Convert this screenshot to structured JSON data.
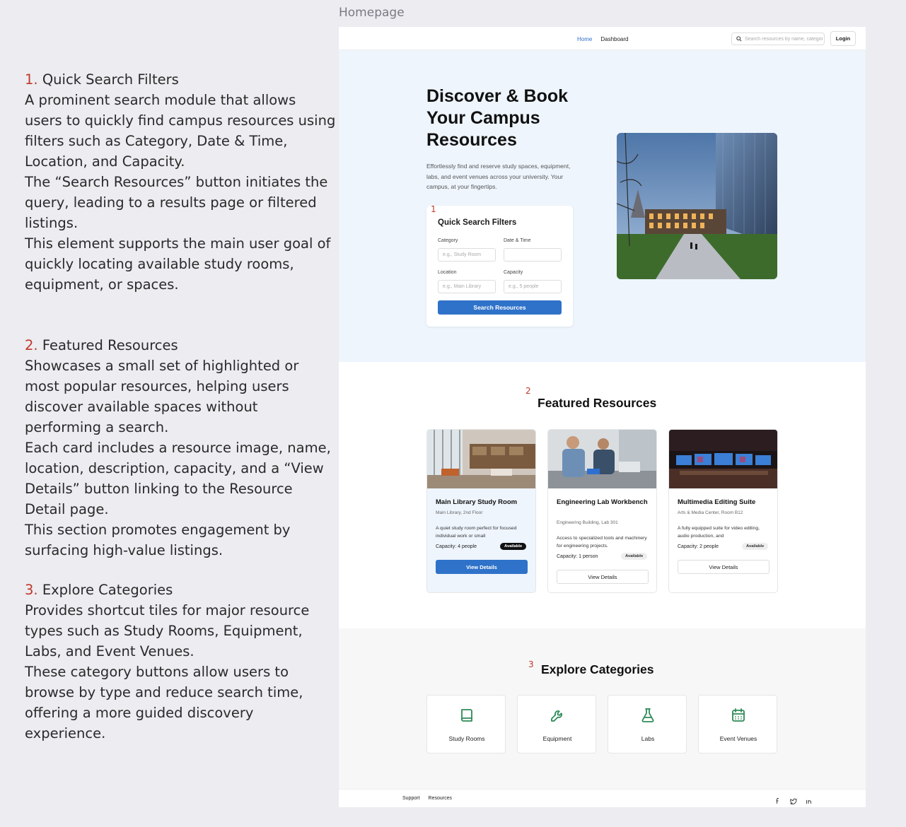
{
  "frame_label": "Homepage",
  "annotations": [
    {
      "num": "1.",
      "title": "Quick Search Filters",
      "lines": [
        "A prominent search module that allows users to quickly find campus resources using filters such as Category, Date & Time, Location, and Capacity.",
        "The “Search Resources” button initiates the query, leading to a results page or filtered listings.",
        "This element supports the main user goal of quickly locating available study rooms, equipment, or spaces."
      ]
    },
    {
      "num": "2.",
      "title": "Featured Resources",
      "lines": [
        "Showcases a small set of highlighted or most popular resources, helping users discover available spaces without performing a search.",
        "Each card includes a resource image, name, location, description, capacity, and a “View Details” button linking to the Resource Detail page.",
        "This section promotes engagement by surfacing high-value listings."
      ]
    },
    {
      "num": "3.",
      "title": "Explore Categories",
      "lines": [
        "Provides shortcut tiles for major resource types such as Study Rooms, Equipment, Labs, and Event Venues.",
        "These category buttons allow users to browse by type and reduce search time, offering a more guided discovery experience."
      ]
    }
  ],
  "header": {
    "nav": [
      "Home",
      "Dashboard"
    ],
    "search_placeholder": "Search resources by name, category...",
    "login": "Login"
  },
  "hero": {
    "title": "Discover & Book Your Campus Resources",
    "description": "Effortlessly find and reserve study spaces, equipment, labs, and event venues across your university. Your campus, at your fingertips.",
    "image_alt": "Modern glass campus building at dusk"
  },
  "quick_search": {
    "marker": "1",
    "title": "Quick Search Filters",
    "fields": [
      {
        "label": "Category",
        "placeholder": "e.g., Study Room"
      },
      {
        "label": "Date & Time",
        "placeholder": ""
      },
      {
        "label": "Location",
        "placeholder": "e.g., Main Library"
      },
      {
        "label": "Capacity",
        "placeholder": "e.g., 5 people"
      }
    ],
    "button": "Search Resources"
  },
  "featured": {
    "marker": "2",
    "title": "Featured Resources",
    "cards": [
      {
        "name": "Main Library Study Room",
        "location": "Main Library, 2nd Floor",
        "description": "A quiet study room perfect for focused individual work or small",
        "capacity": "Capacity: 4 people",
        "status": "Available",
        "button": "View Details"
      },
      {
        "name": "Engineering Lab Workbench",
        "location": "Engineering Building, Lab 301",
        "description": "Access to specialized tools and machinery for engineering projects.",
        "capacity": "Capacity: 1 person",
        "status": "Available",
        "button": "View Details"
      },
      {
        "name": "Multimedia Editing Suite",
        "location": "Arts & Media Center, Room B12",
        "description": "A fully equipped suite for video editing, audio production, and",
        "capacity": "Capacity: 2 people",
        "status": "Available",
        "button": "View Details"
      }
    ]
  },
  "categories": {
    "marker": "3",
    "title": "Explore Categories",
    "items": [
      {
        "label": "Study Rooms",
        "icon": "book-icon"
      },
      {
        "label": "Equipment",
        "icon": "wrench-icon"
      },
      {
        "label": "Labs",
        "icon": "flask-icon"
      },
      {
        "label": "Event Venues",
        "icon": "calendar-icon"
      }
    ],
    "icon_color": "#2e8b57"
  },
  "footer": {
    "links": [
      "Support",
      "Resources"
    ],
    "social": [
      "facebook-icon",
      "twitter-icon",
      "linkedin-icon"
    ]
  },
  "colors": {
    "accent": "#2f72c9",
    "hero_bg": "#eef5fd",
    "marker": "#c0392b"
  }
}
